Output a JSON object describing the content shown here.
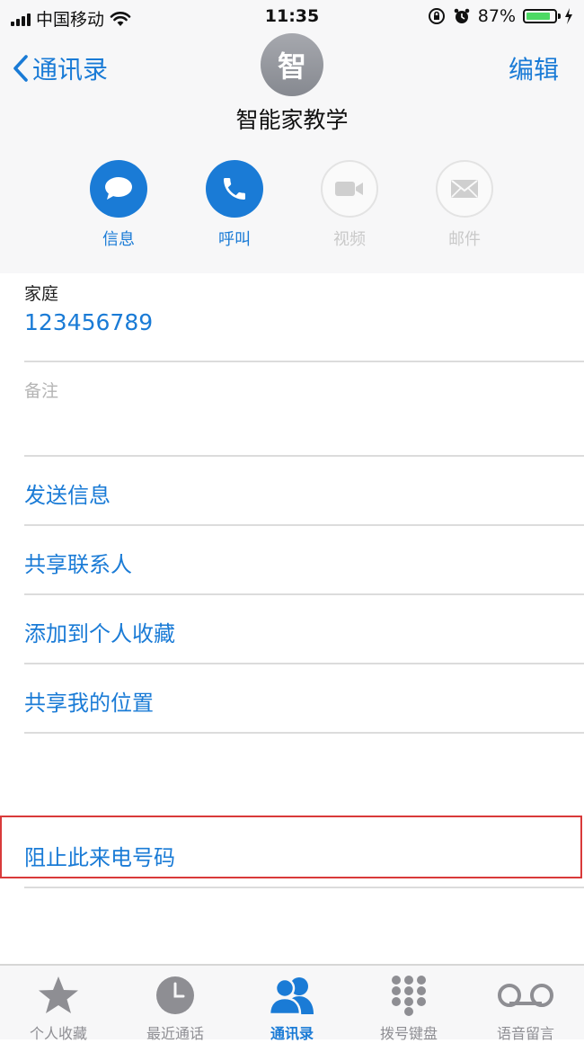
{
  "status_bar": {
    "carrier": "中国移动",
    "time": "11:35",
    "battery_percent": "87%",
    "battery_level": 0.87
  },
  "nav": {
    "back_label": "通讯录",
    "edit_label": "编辑"
  },
  "contact": {
    "avatar_initial": "智",
    "name": "智能家教学"
  },
  "actions": [
    {
      "label": "信息",
      "icon": "message-icon",
      "enabled": true
    },
    {
      "label": "呼叫",
      "icon": "phone-icon",
      "enabled": true
    },
    {
      "label": "视频",
      "icon": "video-icon",
      "enabled": false
    },
    {
      "label": "邮件",
      "icon": "mail-icon",
      "enabled": false
    }
  ],
  "phone": {
    "label": "家庭",
    "number": "123456789"
  },
  "notes": {
    "label": "备注"
  },
  "links": {
    "send_message": "发送信息",
    "share_contact": "共享联系人",
    "add_favorites": "添加到个人收藏",
    "share_location": "共享我的位置",
    "block_caller": "阻止此来电号码"
  },
  "tabbar": {
    "items": [
      {
        "label": "个人收藏",
        "icon": "star-icon",
        "active": false
      },
      {
        "label": "最近通话",
        "icon": "clock-icon",
        "active": false
      },
      {
        "label": "通讯录",
        "icon": "contacts-icon",
        "active": true
      },
      {
        "label": "拨号键盘",
        "icon": "keypad-icon",
        "active": false
      },
      {
        "label": "语音留言",
        "icon": "voicemail-icon",
        "active": false
      }
    ]
  },
  "colors": {
    "accent": "#1a7bd6",
    "highlight_border": "#d93a3a",
    "battery_fill": "#4cd964"
  }
}
